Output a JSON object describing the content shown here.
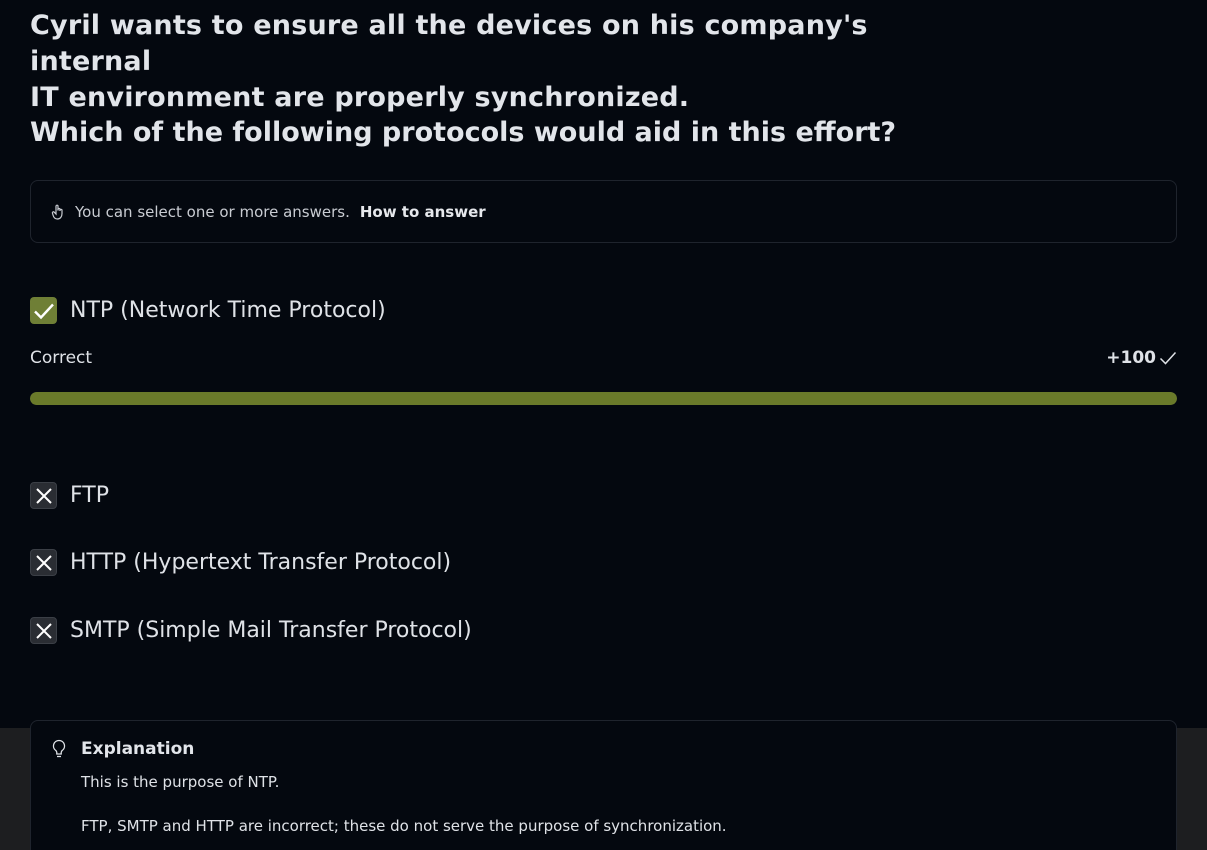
{
  "question": {
    "line1": "Cyril wants to ensure all the devices on his company's internal",
    "line2": "IT environment are properly synchronized.",
    "prompt": "Which of the following protocols would aid in this effort?"
  },
  "hint": {
    "icon": "hand-pointer-icon",
    "text": "You can select one or more answers.",
    "link": "How to answer"
  },
  "options": [
    {
      "label": "NTP (Network Time Protocol)",
      "state": "selected-correct"
    },
    {
      "label": "FTP",
      "state": "incorrect"
    },
    {
      "label": "HTTP (Hypertext Transfer Protocol)",
      "state": "incorrect"
    },
    {
      "label": "SMTP (Simple Mail Transfer Protocol)",
      "state": "incorrect"
    }
  ],
  "result": {
    "status": "Correct",
    "score": "+100",
    "progress": 1.0
  },
  "explanation": {
    "title": "Explanation",
    "p1": "This is the purpose of NTP.",
    "p2": "FTP, SMTP and HTTP are incorrect; these do not serve the purpose of synchronization."
  },
  "colors": {
    "background": "#04080f",
    "correct_green": "#6a7a2a",
    "text": "#e2e5ea"
  }
}
